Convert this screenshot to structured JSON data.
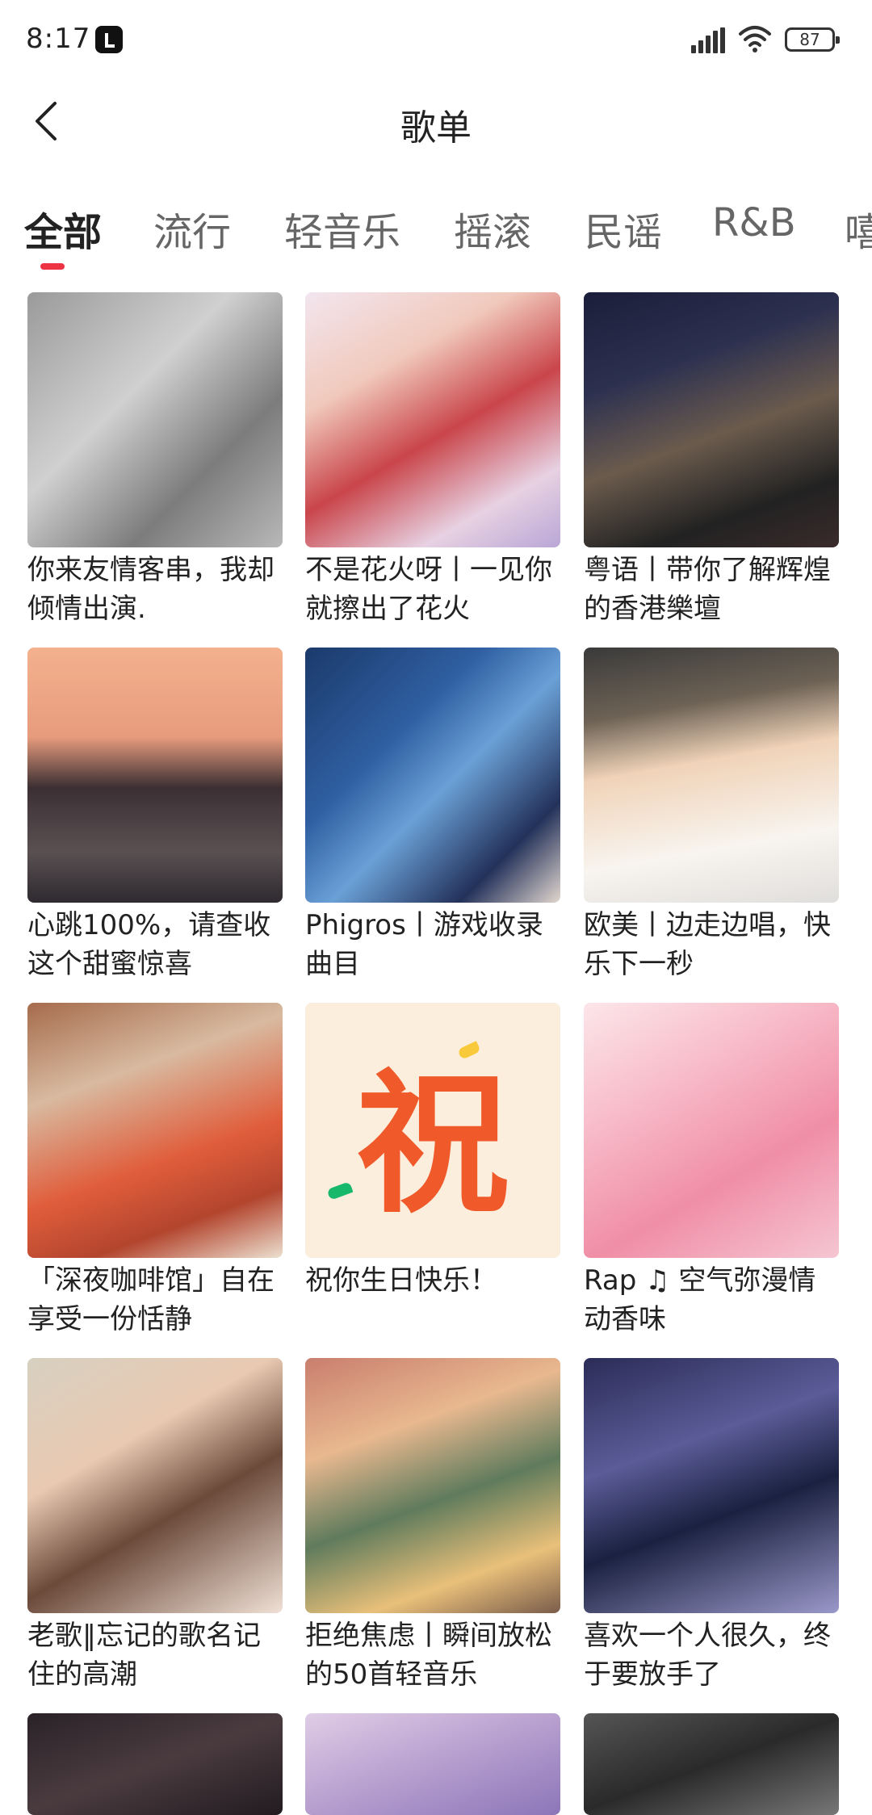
{
  "status_bar": {
    "time": "8:17",
    "battery": "87"
  },
  "header": {
    "title": "歌单"
  },
  "tabs": [
    {
      "label": "全部"
    },
    {
      "label": "流行"
    },
    {
      "label": "轻音乐"
    },
    {
      "label": "摇滚"
    },
    {
      "label": "民谣"
    },
    {
      "label": "R&B"
    },
    {
      "label": "嘻"
    }
  ],
  "playlists": [
    {
      "title": "你来友情客串，我却倾情出演."
    },
    {
      "title": "不是花火呀丨一见你就擦出了花火"
    },
    {
      "title": "粤语丨带你了解辉煌的香港樂壇"
    },
    {
      "title": "心跳100%，请查收这个甜蜜惊喜"
    },
    {
      "title": "Phigros丨游戏收录曲目"
    },
    {
      "title": "欧美丨边走边唱，快乐下一秒"
    },
    {
      "title": "「深夜咖啡馆」自在享受一份恬静"
    },
    {
      "title": "祝你生日快乐！",
      "cover_text": "祝"
    },
    {
      "title": "Rap ♫ 空气弥漫情动香味"
    },
    {
      "title": "老歌‖忘记的歌名记住的高潮"
    },
    {
      "title": "拒绝焦虑丨瞬间放松的50首轻音乐"
    },
    {
      "title": "喜欢一个人很久，终于要放手了"
    },
    {
      "title": ""
    },
    {
      "title": ""
    },
    {
      "title": ""
    }
  ]
}
